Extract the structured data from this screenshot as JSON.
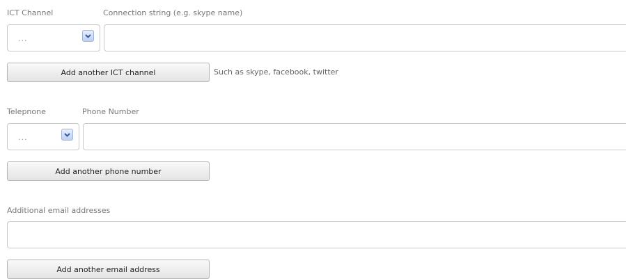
{
  "ict": {
    "channel_label": "ICT Channel",
    "connection_label": "Connection string (e.g. skype name)",
    "select_value": "...",
    "connection_value": "",
    "add_button": "Add another ICT channel",
    "hint": "Such as skype, facebook, twitter"
  },
  "telephone": {
    "type_label": "Telepnone",
    "number_label": "Phone Number",
    "select_value": "...",
    "number_value": "",
    "add_button": "Add another phone number"
  },
  "email": {
    "label": "Additional email addresses",
    "value": "",
    "add_button": "Add another email address"
  },
  "icons": {
    "dropdown": "chevron-down-icon",
    "accent": "#3a5a9c"
  }
}
